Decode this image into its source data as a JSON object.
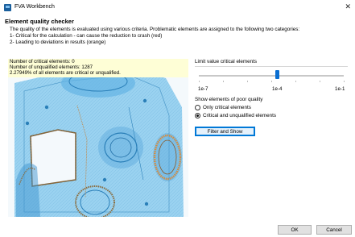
{
  "window": {
    "title": "FVA Workbench",
    "icon": "app-icon"
  },
  "dialog": {
    "heading": "Element quality checker",
    "description": [
      "The quality of the elements is evaluated using various criteria. Problematic elements are assigned to the following two categories:",
      "1- Critical for the calculation - can cause the reduction to crash (red)",
      "2- Leading to deviations in results (orange)"
    ]
  },
  "stats": {
    "critical": "Number of critical elements: 0",
    "unqualified": "Number of unqualified elements: 1287",
    "percent": "2.27949% of all elements are critical or unqualified."
  },
  "limit": {
    "label": "Limit value critical elements",
    "scale_min": "1e-7",
    "scale_mid": "1e-4",
    "scale_max": "1e-1",
    "value_fraction": 0.55
  },
  "show": {
    "label": "Show elements of poor quality",
    "option_critical": "Only critical elements",
    "option_both": "Critical and unqualified elements",
    "selected": "option_both"
  },
  "buttons": {
    "filter": "Filter and Show",
    "ok": "OK",
    "cancel": "Cancel"
  },
  "colors": {
    "model": "#5fb4e6",
    "model_dark": "#2a7fb8",
    "unqualified_marker": "#d98a3a",
    "stats_bg": "#fefed6",
    "accent": "#0a6ed1"
  }
}
